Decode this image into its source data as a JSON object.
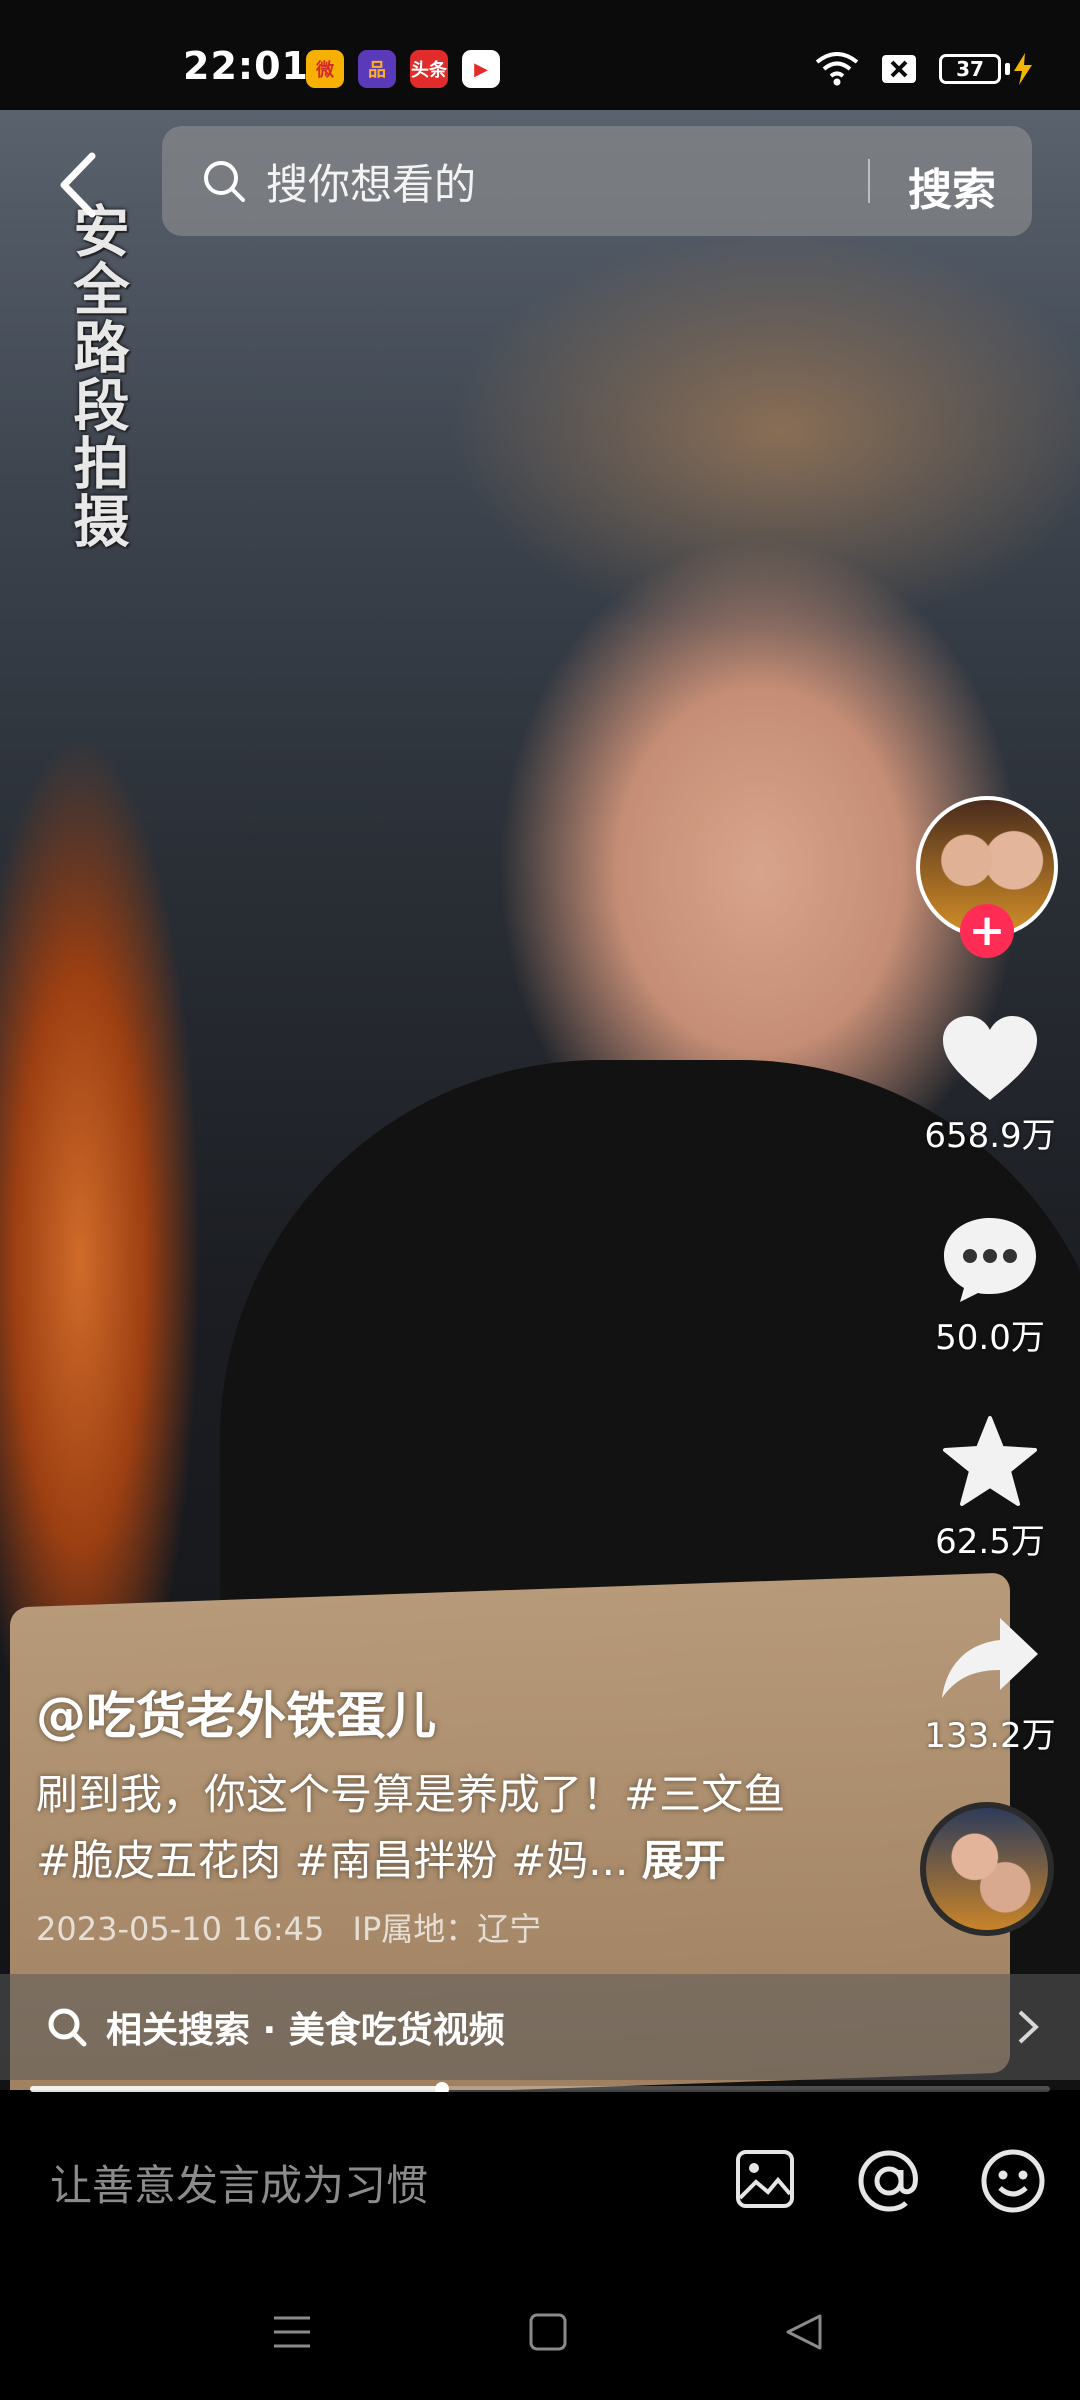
{
  "status_bar": {
    "time": "22:01",
    "apps": [
      {
        "name": "weibo-icon",
        "label": "微",
        "bg": "#f6b000",
        "fg": "#d42a2a"
      },
      {
        "name": "app-orange-icon",
        "label": "品",
        "bg": "#5a3ab8",
        "fg": "#ffb020"
      },
      {
        "name": "toutiao-icon",
        "label": "头条",
        "bg": "#e22b2b",
        "fg": "#ffffff"
      },
      {
        "name": "video-app-icon",
        "label": "▶",
        "bg": "#ffffff",
        "fg": "#e22b2b"
      }
    ],
    "battery": "37"
  },
  "watermark": "安全路段拍摄",
  "search": {
    "placeholder": "搜你想看的",
    "button": "搜索"
  },
  "actions": {
    "likes": "658.9万",
    "comments": "50.0万",
    "favorites": "62.5万",
    "shares": "133.2万"
  },
  "post": {
    "author": "@吃货老外铁蛋儿",
    "description": "刷到我，你这个号算是养成了！#三文鱼 #脆皮五花肉 #南昌拌粉 #妈...",
    "expand_label": "展开",
    "date": "2023-05-10 16:45",
    "ip_location": "IP属地：辽宁"
  },
  "related_search": {
    "label": "相关搜索 · 美食吃货视频"
  },
  "progress": {
    "fraction": 0.404
  },
  "comment_bar": {
    "placeholder": "让善意发言成为习惯"
  },
  "colors": {
    "accent": "#ff2d55",
    "battery_bolt": "#f4b400"
  }
}
